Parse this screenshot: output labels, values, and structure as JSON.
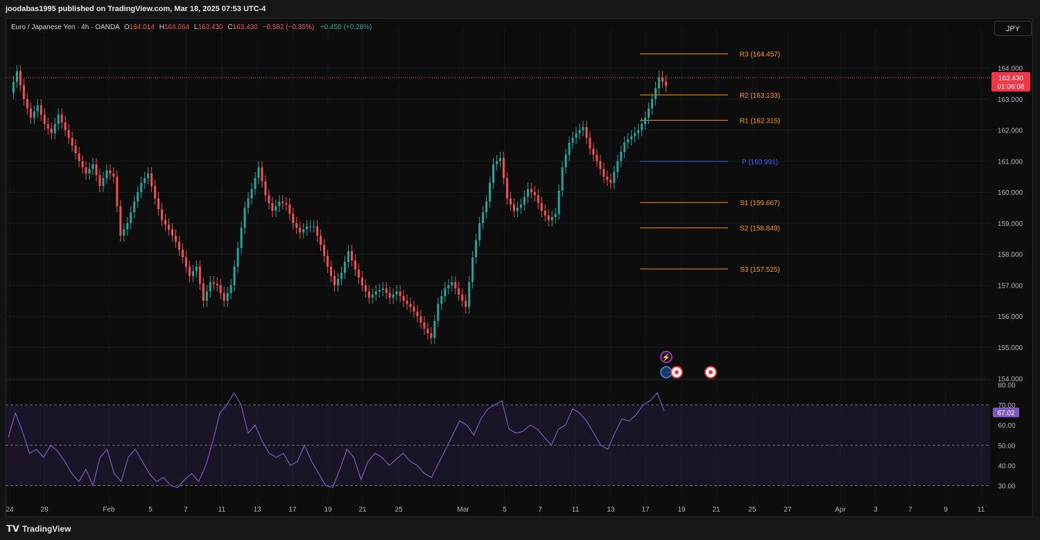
{
  "header": {
    "published": "joodabas1995 published on TradingView.com, Mar 18, 2025 07:53 UTC-4"
  },
  "legend": {
    "symbol": "Euro / Japanese Yen · 4h · OANDA",
    "o_label": "O",
    "o_value": "164.014",
    "h_label": "H",
    "h_value": "164.064",
    "l_label": "L",
    "l_value": "163.430",
    "c_label": "C",
    "c_value": "163.430",
    "change": "−0.582 (−0.35%)",
    "extra": "+0.450 (+0.28%)"
  },
  "currency_button": "JPY",
  "price_tag": {
    "price": "163.430",
    "countdown": "01:06:08"
  },
  "rsi_tag": "67.02",
  "footer": {
    "brand": "TradingView"
  },
  "colors": {
    "up": "#26a69a",
    "down": "#ef5350",
    "pivot": "#2962ff",
    "level": "#ff9800",
    "rsi": "#7e57c2"
  },
  "chart_data": {
    "type": "candlestick",
    "symbol": "EURJPY",
    "timeframe": "4h",
    "price_axis": {
      "ticks": [
        "164.000",
        "163.000",
        "162.000",
        "161.000",
        "160.000",
        "159.000",
        "158.000",
        "157.000",
        "156.000",
        "155.000",
        "154.000"
      ],
      "range": [
        153.95,
        165.3
      ]
    },
    "time_axis": [
      "24",
      "28",
      "Feb",
      "5",
      "7",
      "11",
      "13",
      "17",
      "19",
      "21",
      "25",
      "Mar",
      "5",
      "7",
      "11",
      "13",
      "17",
      "19",
      "21",
      "25",
      "27",
      "Apr",
      "3",
      "7",
      "9",
      "11"
    ],
    "pivot_levels": [
      {
        "label": "R3 (164.457)",
        "value": 164.457
      },
      {
        "label": "R2 (163.133)",
        "value": 163.133
      },
      {
        "label": "R1 (162.315)",
        "value": 162.315
      },
      {
        "label": "P (160.991)",
        "value": 160.991
      },
      {
        "label": "S1 (159.667)",
        "value": 159.667
      },
      {
        "label": "S2 (158.849)",
        "value": 158.849
      },
      {
        "label": "S3 (157.525)",
        "value": 157.525
      }
    ],
    "close_series": [
      163.2,
      163.9,
      163.0,
      162.4,
      162.8,
      162.2,
      161.9,
      162.5,
      162.0,
      161.5,
      161.0,
      160.6,
      160.9,
      160.2,
      160.7,
      160.5,
      158.6,
      159.0,
      159.7,
      160.3,
      160.6,
      159.8,
      159.1,
      158.8,
      158.4,
      157.9,
      157.3,
      157.6,
      156.5,
      157.1,
      157.0,
      156.5,
      157.0,
      158.2,
      159.5,
      160.1,
      160.8,
      159.9,
      159.4,
      159.7,
      159.6,
      159.0,
      158.7,
      158.9,
      158.9,
      158.3,
      157.6,
      157.0,
      157.4,
      158.1,
      157.5,
      157.0,
      156.6,
      156.8,
      156.9,
      156.6,
      156.8,
      156.5,
      156.3,
      156.0,
      155.6,
      155.3,
      156.4,
      156.9,
      157.1,
      156.7,
      156.3,
      157.9,
      159.0,
      159.7,
      160.9,
      161.1,
      159.8,
      159.4,
      159.6,
      160.1,
      159.9,
      159.4,
      159.1,
      159.3,
      160.8,
      161.6,
      161.9,
      162.1,
      161.4,
      161.0,
      160.5,
      160.3,
      161.0,
      161.6,
      161.8,
      162.0,
      162.4,
      163.0,
      163.7,
      163.43
    ],
    "rsi": {
      "ticks": [
        "80.00",
        "70.00",
        "60.00",
        "50.00",
        "40.00",
        "30.00"
      ],
      "range": [
        24,
        81
      ],
      "band": [
        30,
        70
      ],
      "mid": 50,
      "value": 67.02,
      "series": [
        54,
        66,
        57,
        46,
        48,
        44,
        50,
        47,
        42,
        36,
        32,
        38,
        30,
        44,
        48,
        36,
        32,
        44,
        48,
        42,
        36,
        32,
        34,
        30,
        29,
        33,
        36,
        32,
        40,
        52,
        66,
        70,
        76,
        70,
        56,
        60,
        52,
        46,
        44,
        46,
        40,
        42,
        50,
        42,
        36,
        30,
        29,
        38,
        48,
        44,
        33,
        42,
        46,
        44,
        40,
        43,
        46,
        42,
        40,
        36,
        34,
        41,
        48,
        55,
        62,
        60,
        55,
        63,
        68,
        70,
        72,
        58,
        56,
        57,
        60,
        58,
        54,
        50,
        58,
        60,
        68,
        66,
        62,
        56,
        50,
        48,
        56,
        63,
        62,
        65,
        70,
        72,
        76,
        67
      ]
    }
  }
}
